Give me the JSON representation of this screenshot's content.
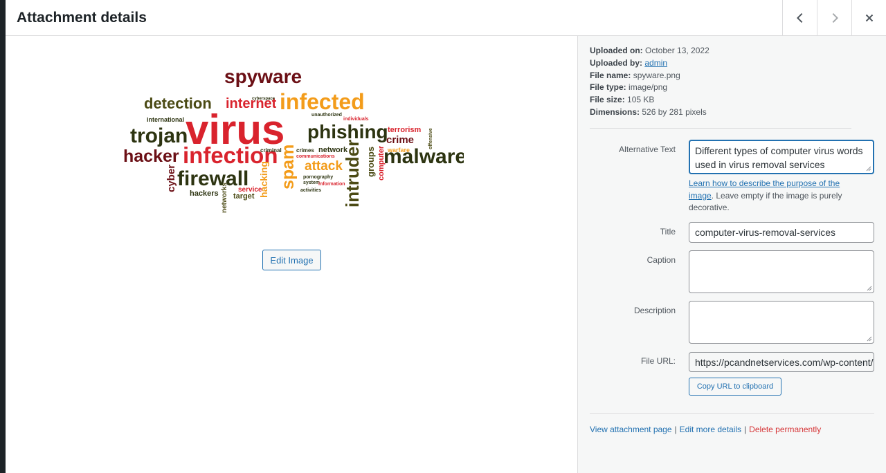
{
  "header": {
    "title": "Attachment details",
    "prev_icon": "chevron-left-icon",
    "next_icon": "chevron-right-icon",
    "close_icon": "close-icon"
  },
  "preview": {
    "edit_image_label": "Edit Image",
    "words": [
      "spyware",
      "detection",
      "internet",
      "infected",
      "international",
      "virus",
      "trojan",
      "phishing",
      "terrorism",
      "crime",
      "hacker",
      "infection",
      "malware",
      "intruder",
      "spam",
      "attack",
      "cyber",
      "firewall",
      "hackers",
      "target",
      "service",
      "networks",
      "hacking",
      "computer",
      "groups",
      "network",
      "criminal",
      "communications",
      "crimes",
      "warfare",
      "pornography",
      "system",
      "information",
      "activities",
      "unauthorized",
      "individuals",
      "cyberspace",
      "offensive"
    ]
  },
  "meta": {
    "uploaded_on_label": "Uploaded on:",
    "uploaded_on": "October 13, 2022",
    "uploaded_by_label": "Uploaded by:",
    "uploaded_by": "admin",
    "file_name_label": "File name:",
    "file_name": "spyware.png",
    "file_type_label": "File type:",
    "file_type": "image/png",
    "file_size_label": "File size:",
    "file_size": "105 KB",
    "dimensions_label": "Dimensions:",
    "dimensions": "526 by 281 pixels"
  },
  "form": {
    "alt_label": "Alternative Text",
    "alt_value": "Different types of computer virus words used in virus removal services",
    "alt_help_link": "Learn how to describe the purpose of the image",
    "alt_help_text": ". Leave empty if the image is purely decorative.",
    "title_label": "Title",
    "title_value": "computer-virus-removal-services",
    "caption_label": "Caption",
    "caption_value": "",
    "description_label": "Description",
    "description_value": "",
    "url_label": "File URL:",
    "url_value": "https://pcandnetservices.com/wp-content/uploads/2022/10/spyware.png",
    "copy_label": "Copy URL to clipboard"
  },
  "actions": {
    "view": "View attachment page",
    "sep1": "|",
    "edit": "Edit more details",
    "sep2": "|",
    "delete": "Delete permanently"
  },
  "colors": {
    "accent": "#2271b1",
    "danger": "#d63638",
    "word_red": "#d9232d",
    "word_darkred": "#6b0f15",
    "word_orange": "#f39c1a",
    "word_olive": "#4b4a14",
    "word_darkolive": "#2d3411"
  }
}
